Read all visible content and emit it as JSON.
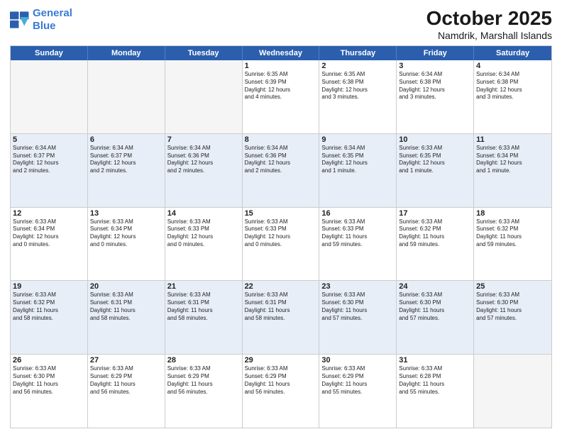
{
  "header": {
    "logo_line1": "General",
    "logo_line2": "Blue",
    "month": "October 2025",
    "location": "Namdrik, Marshall Islands"
  },
  "day_headers": [
    "Sunday",
    "Monday",
    "Tuesday",
    "Wednesday",
    "Thursday",
    "Friday",
    "Saturday"
  ],
  "weeks": [
    [
      {
        "num": "",
        "info": "",
        "empty": true
      },
      {
        "num": "",
        "info": "",
        "empty": true
      },
      {
        "num": "",
        "info": "",
        "empty": true
      },
      {
        "num": "1",
        "info": "Sunrise: 6:35 AM\nSunset: 6:39 PM\nDaylight: 12 hours\nand 4 minutes."
      },
      {
        "num": "2",
        "info": "Sunrise: 6:35 AM\nSunset: 6:38 PM\nDaylight: 12 hours\nand 3 minutes."
      },
      {
        "num": "3",
        "info": "Sunrise: 6:34 AM\nSunset: 6:38 PM\nDaylight: 12 hours\nand 3 minutes."
      },
      {
        "num": "4",
        "info": "Sunrise: 6:34 AM\nSunset: 6:38 PM\nDaylight: 12 hours\nand 3 minutes."
      }
    ],
    [
      {
        "num": "5",
        "info": "Sunrise: 6:34 AM\nSunset: 6:37 PM\nDaylight: 12 hours\nand 2 minutes."
      },
      {
        "num": "6",
        "info": "Sunrise: 6:34 AM\nSunset: 6:37 PM\nDaylight: 12 hours\nand 2 minutes."
      },
      {
        "num": "7",
        "info": "Sunrise: 6:34 AM\nSunset: 6:36 PM\nDaylight: 12 hours\nand 2 minutes."
      },
      {
        "num": "8",
        "info": "Sunrise: 6:34 AM\nSunset: 6:36 PM\nDaylight: 12 hours\nand 2 minutes."
      },
      {
        "num": "9",
        "info": "Sunrise: 6:34 AM\nSunset: 6:35 PM\nDaylight: 12 hours\nand 1 minute."
      },
      {
        "num": "10",
        "info": "Sunrise: 6:33 AM\nSunset: 6:35 PM\nDaylight: 12 hours\nand 1 minute."
      },
      {
        "num": "11",
        "info": "Sunrise: 6:33 AM\nSunset: 6:34 PM\nDaylight: 12 hours\nand 1 minute."
      }
    ],
    [
      {
        "num": "12",
        "info": "Sunrise: 6:33 AM\nSunset: 6:34 PM\nDaylight: 12 hours\nand 0 minutes."
      },
      {
        "num": "13",
        "info": "Sunrise: 6:33 AM\nSunset: 6:34 PM\nDaylight: 12 hours\nand 0 minutes."
      },
      {
        "num": "14",
        "info": "Sunrise: 6:33 AM\nSunset: 6:33 PM\nDaylight: 12 hours\nand 0 minutes."
      },
      {
        "num": "15",
        "info": "Sunrise: 6:33 AM\nSunset: 6:33 PM\nDaylight: 12 hours\nand 0 minutes."
      },
      {
        "num": "16",
        "info": "Sunrise: 6:33 AM\nSunset: 6:33 PM\nDaylight: 11 hours\nand 59 minutes."
      },
      {
        "num": "17",
        "info": "Sunrise: 6:33 AM\nSunset: 6:32 PM\nDaylight: 11 hours\nand 59 minutes."
      },
      {
        "num": "18",
        "info": "Sunrise: 6:33 AM\nSunset: 6:32 PM\nDaylight: 11 hours\nand 59 minutes."
      }
    ],
    [
      {
        "num": "19",
        "info": "Sunrise: 6:33 AM\nSunset: 6:32 PM\nDaylight: 11 hours\nand 58 minutes."
      },
      {
        "num": "20",
        "info": "Sunrise: 6:33 AM\nSunset: 6:31 PM\nDaylight: 11 hours\nand 58 minutes."
      },
      {
        "num": "21",
        "info": "Sunrise: 6:33 AM\nSunset: 6:31 PM\nDaylight: 11 hours\nand 58 minutes."
      },
      {
        "num": "22",
        "info": "Sunrise: 6:33 AM\nSunset: 6:31 PM\nDaylight: 11 hours\nand 58 minutes."
      },
      {
        "num": "23",
        "info": "Sunrise: 6:33 AM\nSunset: 6:30 PM\nDaylight: 11 hours\nand 57 minutes."
      },
      {
        "num": "24",
        "info": "Sunrise: 6:33 AM\nSunset: 6:30 PM\nDaylight: 11 hours\nand 57 minutes."
      },
      {
        "num": "25",
        "info": "Sunrise: 6:33 AM\nSunset: 6:30 PM\nDaylight: 11 hours\nand 57 minutes."
      }
    ],
    [
      {
        "num": "26",
        "info": "Sunrise: 6:33 AM\nSunset: 6:30 PM\nDaylight: 11 hours\nand 56 minutes."
      },
      {
        "num": "27",
        "info": "Sunrise: 6:33 AM\nSunset: 6:29 PM\nDaylight: 11 hours\nand 56 minutes."
      },
      {
        "num": "28",
        "info": "Sunrise: 6:33 AM\nSunset: 6:29 PM\nDaylight: 11 hours\nand 56 minutes."
      },
      {
        "num": "29",
        "info": "Sunrise: 6:33 AM\nSunset: 6:29 PM\nDaylight: 11 hours\nand 56 minutes."
      },
      {
        "num": "30",
        "info": "Sunrise: 6:33 AM\nSunset: 6:29 PM\nDaylight: 11 hours\nand 55 minutes."
      },
      {
        "num": "31",
        "info": "Sunrise: 6:33 AM\nSunset: 6:28 PM\nDaylight: 11 hours\nand 55 minutes."
      },
      {
        "num": "",
        "info": "",
        "empty": true
      }
    ]
  ]
}
